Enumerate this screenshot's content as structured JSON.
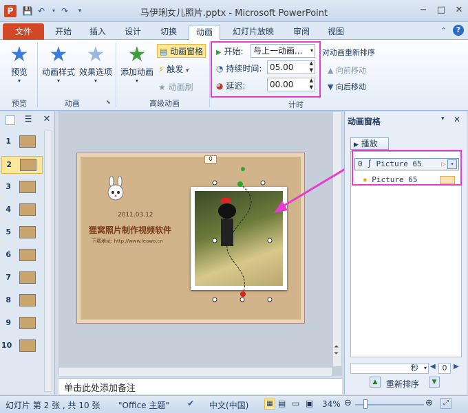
{
  "window": {
    "title": "马伊琍女儿照片.pptx - Microsoft PowerPoint",
    "app_icon": "P",
    "min": "−",
    "max": "□",
    "close": "✕"
  },
  "tabs": [
    {
      "label": "文件"
    },
    {
      "label": "开始"
    },
    {
      "label": "插入"
    },
    {
      "label": "设计"
    },
    {
      "label": "切换"
    },
    {
      "label": "动画"
    },
    {
      "label": "幻灯片放映"
    },
    {
      "label": "审阅"
    },
    {
      "label": "视图"
    }
  ],
  "ribbon": {
    "preview": {
      "label": "预览",
      "group": "预览"
    },
    "anim_style": {
      "label": "动画样式"
    },
    "effect_opts": {
      "label": "效果选项"
    },
    "anim_group": "动画",
    "add_anim": {
      "label": "添加动画"
    },
    "anim_pane_btn": "动画窗格",
    "trigger": "触发",
    "anim_brush": "动画刷",
    "adv_group": "高级动画",
    "start_label": "开始:",
    "start_value": "与上一动画...",
    "duration_label": "持续时间:",
    "duration_value": "05.00",
    "delay_label": "延迟:",
    "delay_value": "00.00",
    "timing_group": "计时",
    "reorder_title": "对动画重新排序",
    "move_earlier": "向前移动",
    "move_later": "向后移动"
  },
  "thumbs": [
    "1",
    "2",
    "3",
    "4",
    "5",
    "6",
    "7",
    "8",
    "9",
    "10"
  ],
  "slide": {
    "date": "2011.03.12",
    "heading": "狸窝照片制作视频软件",
    "link": "下载地址: http://www.leawo.cn",
    "badge": "0"
  },
  "anim_pane": {
    "title": "动画窗格",
    "play": "播放",
    "item1_index": "0",
    "item1_name": "Picture 65",
    "item2_name": "Picture 65",
    "seconds": "秒",
    "zoom_value": "0",
    "reorder": "重新排序"
  },
  "notes": {
    "placeholder": "单击此处添加备注"
  },
  "status": {
    "slide_info": "幻灯片 第 2 张 , 共 10 张",
    "theme": "\"Office 主题\"",
    "lang": "中文(中国)",
    "zoom": "34%"
  }
}
